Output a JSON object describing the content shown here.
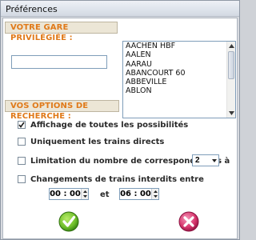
{
  "window": {
    "title": "Préférences"
  },
  "station_section": {
    "header": "VOTRE GARE PRIVILÉGIÉE :",
    "input_value": "",
    "stations": [
      "AACHEN HBF",
      "AALEN",
      "AARAU",
      "ABANCOURT 60",
      "ABBEVILLE",
      "ABLON"
    ]
  },
  "options_section": {
    "header": "VOS OPTIONS DE RECHERCHE :",
    "options": [
      {
        "label": "Affichage de toutes les possibilités",
        "checked": true
      },
      {
        "label": "Uniquement les trains directs",
        "checked": false
      },
      {
        "label": "Limitation du nombre de correspondances à",
        "checked": false
      },
      {
        "label": "Changements de trains interdits entre",
        "checked": false
      }
    ],
    "max_connections": "2",
    "time_from": "00 : 00",
    "time_separator": "et",
    "time_to": "06 : 00"
  },
  "actions": {
    "ok_icon": "check-icon",
    "cancel_icon": "cross-icon",
    "ok_color": "#6fbf2a",
    "cancel_color": "#d6336b"
  }
}
